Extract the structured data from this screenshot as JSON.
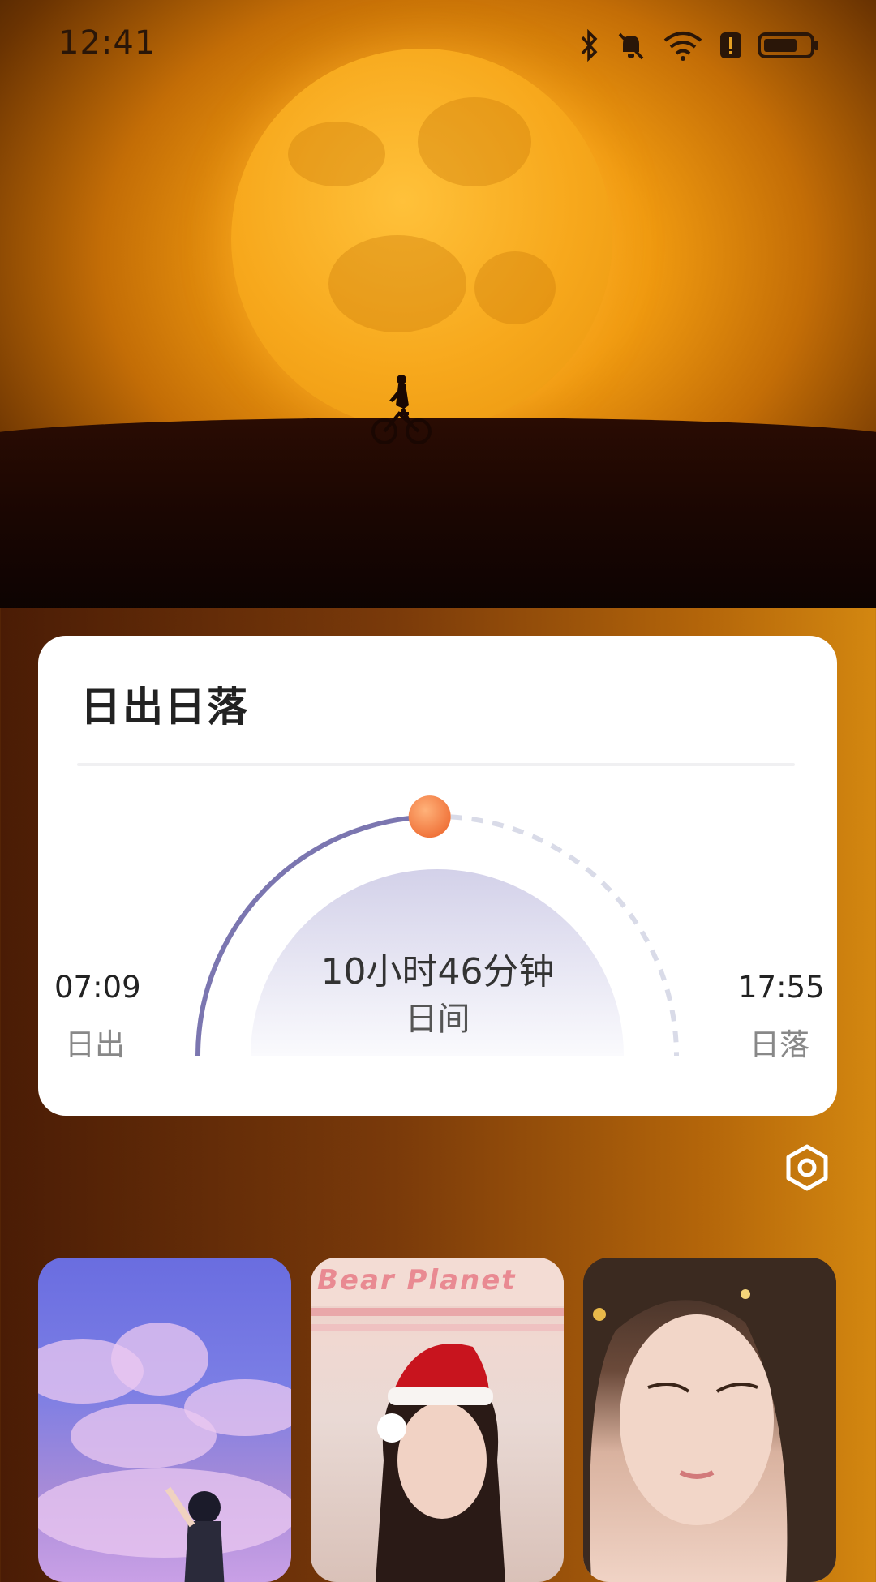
{
  "status_bar": {
    "time": "12:41",
    "icons": [
      "bluetooth-icon",
      "mute-bell-icon",
      "wifi-icon",
      "alert-icon",
      "battery-icon"
    ]
  },
  "hero": {
    "description_icon": "moon-cyclist-wallpaper"
  },
  "sun_card": {
    "title": "日出日落",
    "day_length": "10小时46分钟",
    "day_label": "日间",
    "sunrise_time": "07:09",
    "sunrise_label": "日出",
    "sunset_time": "17:55",
    "sunset_label": "日落",
    "progress_fraction": 0.49,
    "colors": {
      "arc_progress": "#7b76b0",
      "arc_remaining": "#d9dbe8",
      "sun": "#f5884a",
      "dome_top": "#d6d4ea",
      "dome_bottom": "#f7f7fb"
    }
  },
  "settings": {
    "icon": "hexagon-settings-icon"
  },
  "thumbnails": [
    {
      "name": "wallpaper-sky-girl"
    },
    {
      "name": "wallpaper-bear-planet",
      "text": "Bear Planet"
    },
    {
      "name": "wallpaper-fantasy-portrait"
    }
  ]
}
